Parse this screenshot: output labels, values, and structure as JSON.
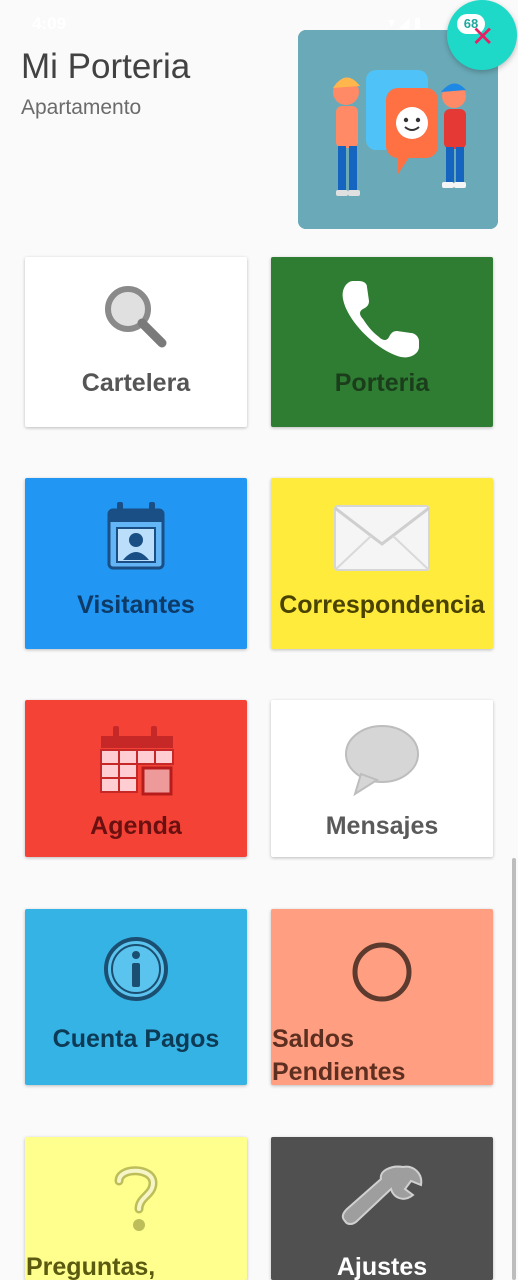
{
  "status_bar": {
    "time": "4:09",
    "battery": "68"
  },
  "header": {
    "title": "Mi Porteria",
    "subtitle": "Apartamento"
  },
  "tiles": [
    {
      "label": "Cartelera",
      "icon": "search-icon",
      "color": "#ffffff"
    },
    {
      "label": "Porteria",
      "icon": "phone-icon",
      "color": "#2e7d32"
    },
    {
      "label": "Visitantes",
      "icon": "visitor-calendar-icon",
      "color": "#2196f3"
    },
    {
      "label": "Correspondencia",
      "icon": "envelope-icon",
      "color": "#ffeb3b"
    },
    {
      "label": "Agenda",
      "icon": "calendar-icon",
      "color": "#f44336"
    },
    {
      "label": "Mensajes",
      "icon": "chat-bubble-icon",
      "color": "#ffffff"
    },
    {
      "label": "Cuenta Pagos",
      "icon": "info-icon",
      "color": "#35b3e5"
    },
    {
      "label": "Saldos Pendientes",
      "label_line1": "Saldos",
      "label_line2": "Pendientes",
      "icon": "circle-icon",
      "color": "#ff9e80"
    },
    {
      "label": "Preguntas,",
      "icon": "question-icon",
      "color": "#ffff8d"
    },
    {
      "label": "Ajustes",
      "icon": "wrench-icon",
      "color": "#505050"
    }
  ]
}
